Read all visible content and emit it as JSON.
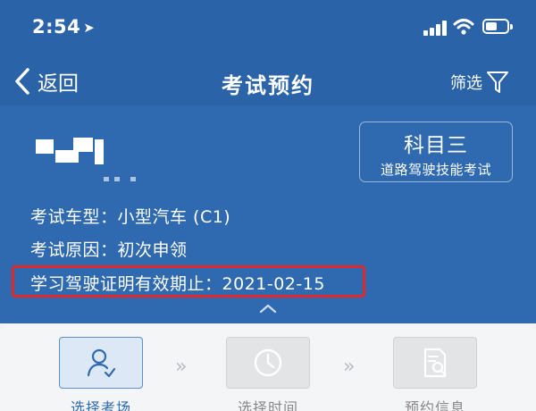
{
  "status_bar": {
    "time": "2:54"
  },
  "nav": {
    "back_label": "返回",
    "title": "考试预约",
    "filter_label": "筛选"
  },
  "subject": {
    "title": "科目三",
    "subtitle": "道路驾驶技能考试"
  },
  "info": {
    "vehicle_type": "考试车型：小型汽车 (C1)",
    "reason": "考试原因：初次申领",
    "permit_expiry": "学习驾驶证明有效期止：2021-02-15"
  },
  "steps": [
    {
      "label": "选择考场",
      "icon": "user-check-icon",
      "state": "active"
    },
    {
      "label": "选择时间",
      "icon": "clock-icon",
      "state": "inactive"
    },
    {
      "label": "预约信息",
      "icon": "document-search-icon",
      "state": "inactive"
    }
  ],
  "colors": {
    "header_blue": "#2f6ab0",
    "highlight_red": "#e02828",
    "active_step": "#5a8fd0"
  }
}
